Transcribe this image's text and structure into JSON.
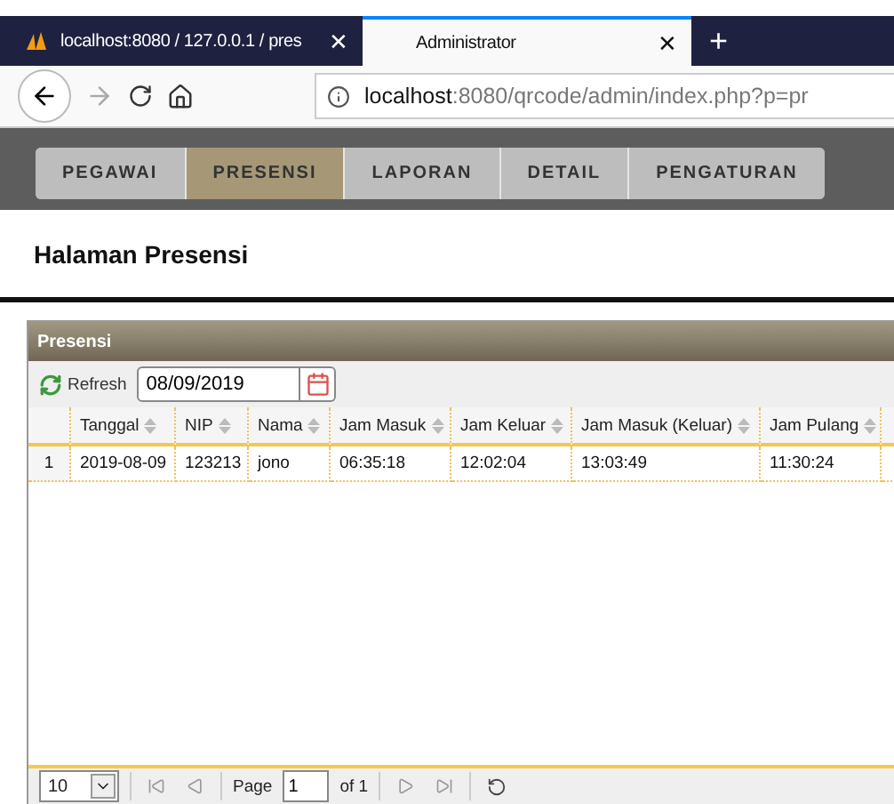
{
  "browser": {
    "tabs": [
      {
        "title": "localhost:8080 / 127.0.0.1 / pres",
        "close": "✕",
        "selected": false
      },
      {
        "title": "Administrator",
        "close": "✕",
        "selected": true
      }
    ],
    "new_tab": "+",
    "url_host": "localhost",
    "url_rest": ":8080/qrcode/admin/index.php?p=pr"
  },
  "menu": [
    {
      "label": "PEGAWAI",
      "selected": false
    },
    {
      "label": "PRESENSI",
      "selected": true
    },
    {
      "label": "LAPORAN",
      "selected": false
    },
    {
      "label": "DETAIL",
      "selected": false
    },
    {
      "label": "PENGATURAN",
      "selected": false
    }
  ],
  "page_title": "Halaman Presensi",
  "panel": {
    "title": "Presensi",
    "refresh": "Refresh",
    "date": "08/09/2019",
    "columns": [
      "Tanggal",
      "NIP",
      "Nama",
      "Jam Masuk",
      "Jam Keluar",
      "Jam Masuk (Keluar)",
      "Jam Pulang"
    ],
    "rows": [
      {
        "number": "1",
        "cells": [
          "2019-08-09",
          "123213",
          "jono",
          "06:35:18",
          "12:02:04",
          "13:03:49",
          "11:30:24"
        ]
      }
    ],
    "pager": {
      "page_size": "10",
      "page_label": "Page",
      "page": "1",
      "of": "of 1"
    }
  }
}
